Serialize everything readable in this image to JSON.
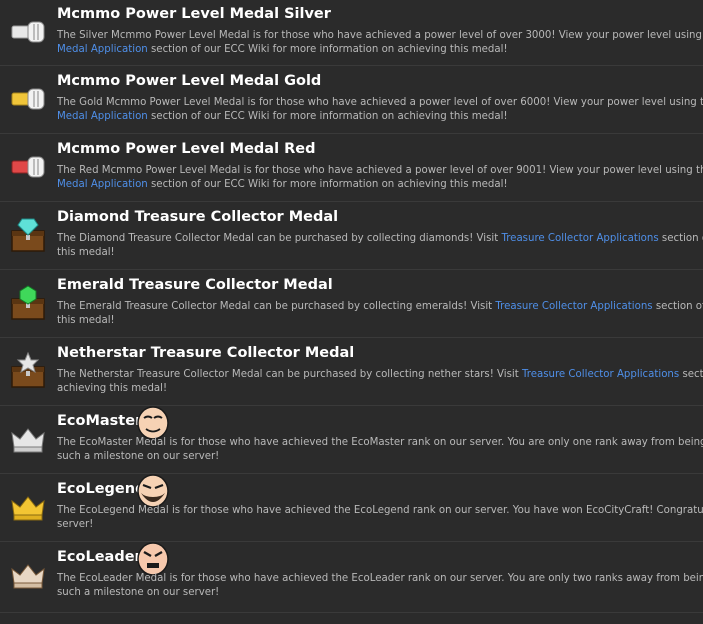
{
  "medals": [
    {
      "icon": "silver-fist-icon",
      "title": "Mcmmo Power Level Medal Silver",
      "line1": "The Silver Mcmmo Power Level Medal is for those who have achieved a power level of over 3000! View your power level using the /",
      "link": "Medal Application",
      "line2": " section of our ECC Wiki for more information on achieving this medal!"
    },
    {
      "icon": "gold-fist-icon",
      "title": "Mcmmo Power Level Medal Gold",
      "line1": "The Gold Mcmmo Power Level Medal is for those who have achieved a power level of over 6000! View your power level using the /m",
      "link": "Medal Application",
      "line2": " section of our ECC Wiki for more information on achieving this medal!"
    },
    {
      "icon": "red-fist-icon",
      "title": "Mcmmo Power Level Medal Red",
      "line1": "The Red Mcmmo Power Level Medal is for those who have achieved a power level of over 9001! View your power level using the /m",
      "link": "Medal Application",
      "line2": " section of our ECC Wiki for more information on achieving this medal!"
    },
    {
      "icon": "diamond-chest-icon",
      "title": "Diamond Treasure Collector Medal",
      "pre": "The Diamond Treasure Collector Medal can be purchased by collecting diamonds! Visit ",
      "link": "Treasure Collector Applications",
      "post": " section of o",
      "line2": "this medal!"
    },
    {
      "icon": "emerald-chest-icon",
      "title": "Emerald Treasure Collector Medal",
      "pre": "The Emerald Treasure Collector Medal can be purchased by collecting emeralds! Visit ",
      "link": "Treasure Collector Applications",
      "post": " section of ou",
      "line2": "this medal!"
    },
    {
      "icon": "netherstar-chest-icon",
      "title": "Netherstar Treasure Collector Medal",
      "pre": "The Netherstar Treasure Collector Medal can be purchased by collecting nether stars! Visit ",
      "link": "Treasure Collector Applications",
      "post": " secti",
      "line2": "achieving this medal!"
    },
    {
      "icon": "silver-crown-icon",
      "title": "EcoMaster",
      "face": "smiling-face-icon",
      "line1": "The EcoMaster Medal is for those who have achieved the EcoMaster rank on our server. You are only one rank away from being a",
      "line2": "such a milestone on our server!"
    },
    {
      "icon": "gold-crown-icon",
      "title": "EcoLegend",
      "face": "bearded-face-icon",
      "line1": "The EcoLegend Medal is for those who have achieved the EcoLegend rank on our server. You have won EcoCityCraft! Congratula",
      "line2": "server!"
    },
    {
      "icon": "bronze-crown-icon",
      "title": "EcoLeader",
      "face": "angry-face-icon",
      "line1": "The EcoLeader Medal is for those who have achieved the EcoLeader rank on our server. You are only two ranks away from being",
      "line2": "such a milestone on our server!"
    }
  ]
}
